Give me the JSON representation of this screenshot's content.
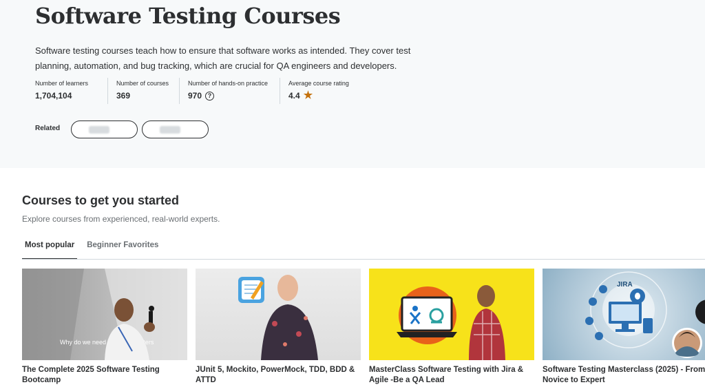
{
  "hero": {
    "title": "Software Testing Courses",
    "description": "Software testing courses teach how to ensure that software works as intended. They cover test planning, automation, and bug tracking, which are crucial for QA engineers and developers.",
    "stats": [
      {
        "label": "Number of learners",
        "value": "1,704,104"
      },
      {
        "label": "Number of courses",
        "value": "369"
      },
      {
        "label": "Number of hands-on practice",
        "value": "970"
      },
      {
        "label": "Average course rating",
        "value": "4.4"
      }
    ],
    "help_icon": "question-circle-icon",
    "rating_icon": "star-icon",
    "rating_color": "#c4710d",
    "related_label": "Related"
  },
  "section": {
    "title": "Courses to get you started",
    "subtitle": "Explore courses from experienced, real-world experts."
  },
  "tabs": [
    {
      "label": "Most popular",
      "active": true
    },
    {
      "label": "Beginner Favorites",
      "active": false
    }
  ],
  "courses": [
    {
      "title": "The Complete 2025 Software Testing Bootcamp",
      "slide_text": "Why do we need Software Testers"
    },
    {
      "title": "JUnit 5, Mockito, PowerMock, TDD, BDD & ATTD"
    },
    {
      "title": "MasterClass Software Testing with Jira & Agile -Be a QA Lead"
    },
    {
      "title": "Software Testing Masterclass (2025) - From Novice to Expert",
      "logo_text": "JIRA"
    }
  ],
  "colors": {
    "hero_bg": "#f7f9fa",
    "text": "#2d2f31",
    "muted": "#6a6f73",
    "border": "#d1d7dc",
    "course3_bg": "#f7e21a"
  }
}
